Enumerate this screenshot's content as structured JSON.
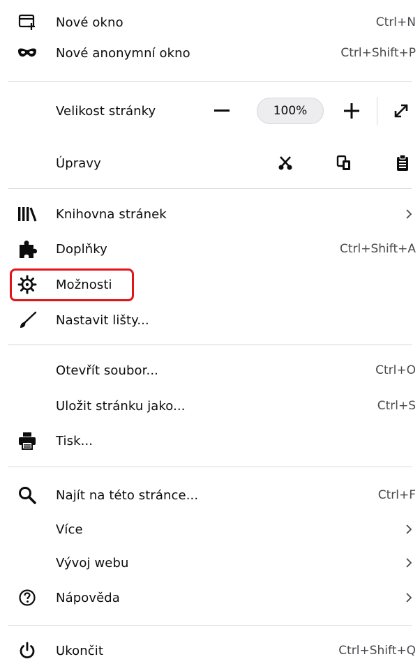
{
  "menu": {
    "new_window": {
      "label": "Nové okno",
      "shortcut": "Ctrl+N",
      "icon": "new-window-icon"
    },
    "private_window": {
      "label": "Nové anonymní okno",
      "shortcut": "Ctrl+Shift+P",
      "icon": "mask-icon"
    },
    "zoom": {
      "label": "Velikost stránky",
      "value": "100%",
      "minus_icon": "minus-icon",
      "plus_icon": "plus-icon",
      "fullscreen_icon": "fullscreen-icon"
    },
    "edit": {
      "label": "Úpravy",
      "cut_icon": "scissors-icon",
      "copy_icon": "copy-icon",
      "paste_icon": "clipboard-icon"
    },
    "library": {
      "label": "Knihovna stránek",
      "icon": "library-icon"
    },
    "addons": {
      "label": "Doplňky",
      "shortcut": "Ctrl+Shift+A",
      "icon": "puzzle-icon"
    },
    "options": {
      "label": "Možnosti",
      "icon": "gear-icon"
    },
    "customize": {
      "label": "Nastavit lišty...",
      "icon": "paintbrush-icon"
    },
    "open_file": {
      "label": "Otevřít soubor...",
      "shortcut": "Ctrl+O"
    },
    "save_page": {
      "label": "Uložit stránku jako...",
      "shortcut": "Ctrl+S"
    },
    "print": {
      "label": "Tisk...",
      "icon": "printer-icon"
    },
    "find": {
      "label": "Najít na této stránce...",
      "shortcut": "Ctrl+F",
      "icon": "search-icon"
    },
    "more": {
      "label": "Více"
    },
    "web_developer": {
      "label": "Vývoj webu"
    },
    "help": {
      "label": "Nápověda",
      "icon": "help-icon"
    },
    "quit": {
      "label": "Ukončit",
      "shortcut": "Ctrl+Shift+Q",
      "icon": "power-icon"
    }
  },
  "colors": {
    "highlight": "#e2141a",
    "text": "#0c0c0d",
    "separator": "#d7d7db"
  }
}
